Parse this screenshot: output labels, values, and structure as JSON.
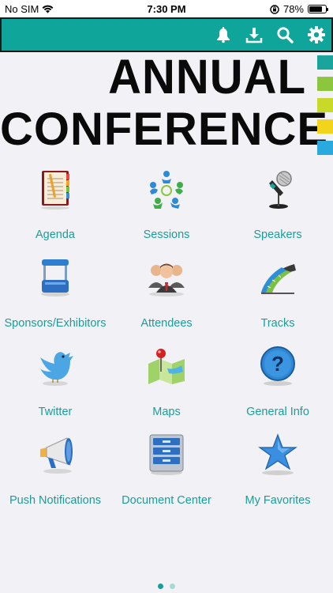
{
  "status_bar": {
    "carrier": "No SIM",
    "time": "7:30 PM",
    "battery": "78%",
    "battery_level": 0.78
  },
  "toolbar": {
    "buttons": [
      {
        "icon": "bell-icon"
      },
      {
        "icon": "download-icon"
      },
      {
        "icon": "search-icon"
      },
      {
        "icon": "gear-icon"
      }
    ],
    "color": "#0fa59b"
  },
  "banner": {
    "line1": "ANNUAL",
    "line2": "CONFERENCE",
    "stripe_colors": [
      "#1aa59c",
      "#8cc63e",
      "#c9d92a",
      "#f2d41c",
      "#2aa9df"
    ]
  },
  "menu": {
    "items": [
      {
        "label": "Agenda",
        "icon": "agenda-book-icon"
      },
      {
        "label": "Sessions",
        "icon": "sessions-people-circle-icon"
      },
      {
        "label": "Speakers",
        "icon": "microphone-icon"
      },
      {
        "label": "Sponsors/Exhibitors",
        "icon": "booth-icon"
      },
      {
        "label": "Attendees",
        "icon": "attendees-group-icon"
      },
      {
        "label": "Tracks",
        "icon": "tracks-road-icon"
      },
      {
        "label": "Twitter",
        "icon": "twitter-bird-icon"
      },
      {
        "label": "Maps",
        "icon": "map-pin-icon"
      },
      {
        "label": "General Info",
        "icon": "question-icon"
      },
      {
        "label": "Push Notifications",
        "icon": "megaphone-icon"
      },
      {
        "label": "Document Center",
        "icon": "file-cabinet-icon"
      },
      {
        "label": "My Favorites",
        "icon": "star-icon"
      }
    ],
    "label_color": "#1a9d9a"
  },
  "pager": {
    "pages": 2,
    "current": 1
  }
}
